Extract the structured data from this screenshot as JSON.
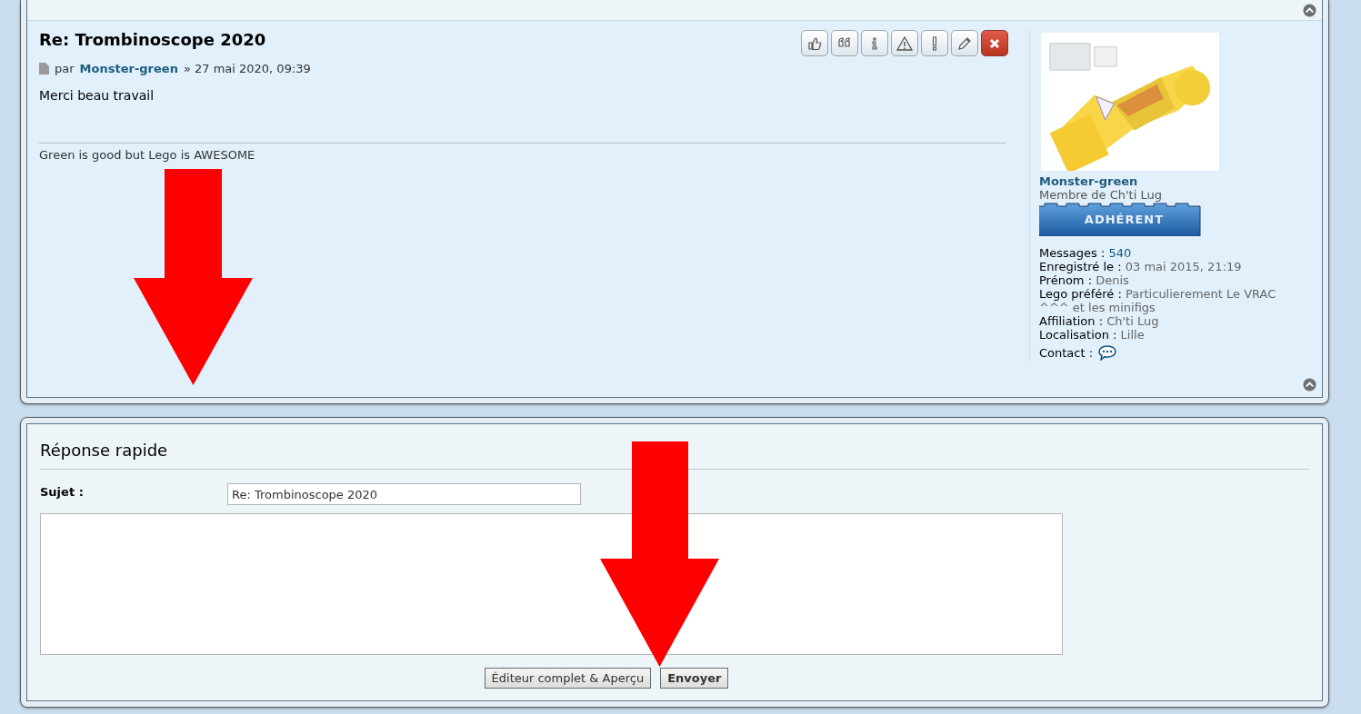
{
  "post": {
    "title": "Re: Trombinoscope 2020",
    "byline_prefix": "par",
    "author": "Monster-green",
    "date": "» 27 mai 2020, 09:39",
    "body": "Merci beau travail",
    "signature": "Green is good but Lego is AWESOME",
    "profile": {
      "username": "Monster-green",
      "rank": "Membre de Ch'ti Lug",
      "rank_badge": "ADHÉRENT",
      "fields": [
        {
          "label": "Messages :",
          "value": "540",
          "kind": "link"
        },
        {
          "label": "Enregistré le :",
          "value": "03 mai 2015, 21:19",
          "kind": "text"
        },
        {
          "label": "Prénom :",
          "value": "Denis",
          "kind": "text"
        },
        {
          "label": "Lego préféré :",
          "value": "Particulierement Le VRAC ^^^ et les minifigs",
          "kind": "text"
        },
        {
          "label": "Affiliation :",
          "value": "Ch'ti Lug",
          "kind": "text"
        },
        {
          "label": "Localisation :",
          "value": "Lille",
          "kind": "text"
        }
      ],
      "contact_label": "Contact :"
    }
  },
  "quick_reply": {
    "title": "Réponse rapide",
    "subject_label": "Sujet :",
    "subject_value": "Re: Trombinoscope 2020",
    "buttons": [
      {
        "label": "Éditeur complet & Aperçu",
        "primary": false
      },
      {
        "label": "Envoyer",
        "primary": true
      }
    ]
  }
}
